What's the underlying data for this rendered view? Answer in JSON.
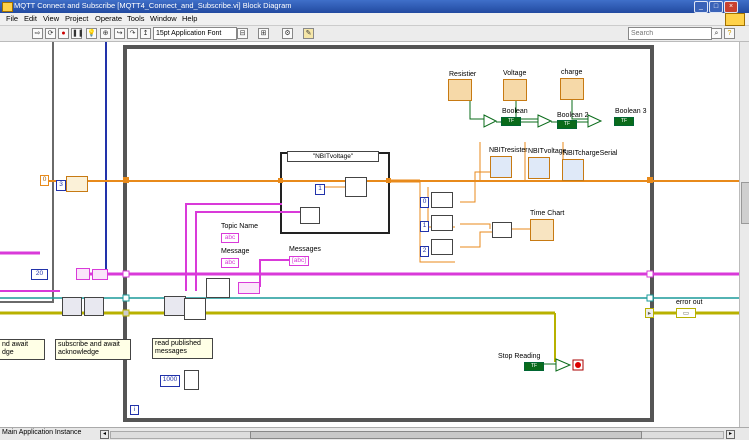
{
  "window": {
    "title": "MQTT Connect and Subscribe [MQTT4_Connect_and_Subscribe.vi] Block Diagram",
    "controls": [
      "_",
      "□",
      "×"
    ]
  },
  "menu": [
    "File",
    "Edit",
    "View",
    "Project",
    "Operate",
    "Tools",
    "Window",
    "Help"
  ],
  "toolbar": {
    "font_select": "15pt Application Font",
    "search_placeholder": "Search"
  },
  "diagram": {
    "case_selector": "\"NBITvoltage\"",
    "labels": {
      "resistor": "Resistier",
      "voltage": "Voltage",
      "charge": "charge",
      "boolean": "Boolean",
      "boolean2": "Boolean 2",
      "boolean3": "Boolean 3",
      "nbit_resister": "NBITresister",
      "nbit_voltage": "NBITvoltage",
      "nbit_charge": "NBITchargeSerial",
      "time_chart": "Time Chart",
      "topic_name": "Topic Name",
      "message": "Message",
      "messages": "Messages",
      "error_out": "error out",
      "stop_reading": "Stop Reading"
    },
    "constants": {
      "zero_left": "0",
      "num_20": "20",
      "timeout": "1000",
      "idx0": "0",
      "idx1": "1",
      "idx2": "2",
      "one": "1",
      "loop_i": "i"
    },
    "comments": {
      "left": "nd await\ndge",
      "subscribe": "subscribe and await\nacknowledge",
      "read": "read published\nmessages"
    }
  },
  "status": {
    "instance": "Main Application Instance"
  },
  "colors": {
    "orange_wire": "#e88a1b",
    "pink_wire": "#d93ad9",
    "teal_wire": "#1a9a9a",
    "yellow_wire": "#b8b100",
    "blue_wire": "#2233aa"
  }
}
